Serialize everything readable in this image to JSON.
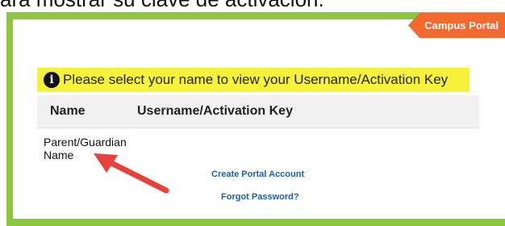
{
  "caption": {
    "text": "ara mostrar su clave de activación."
  },
  "portal": {
    "tab_label": "Campus Portal"
  },
  "notice": {
    "text": "Please select your name to view your Username/Activation Key"
  },
  "table": {
    "headers": [
      "Name",
      "Username/Activation Key"
    ],
    "rows": [
      {
        "name": "Parent/Guardian Name",
        "key": ""
      }
    ]
  },
  "links": {
    "create_account": "Create Portal Account",
    "forgot_password": "Forgot Password?"
  },
  "colors": {
    "frame_green": "#8dc63f",
    "tab_orange": "#f26a2e",
    "highlight_yellow": "#f6f23b",
    "link_blue": "#1f5fa8",
    "arrow_red": "#e8403a"
  }
}
